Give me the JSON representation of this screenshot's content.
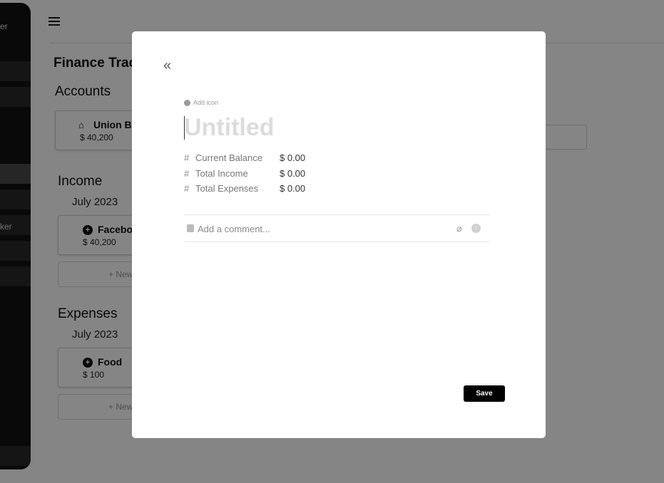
{
  "background": {
    "sidebar": {
      "item_top": "er",
      "item_mid": "ker"
    },
    "page_title": "Finance Track",
    "accounts": {
      "heading": "Accounts",
      "card": {
        "title": "Union Ba",
        "value": "$ 40,200",
        "icon": "bank-icon"
      }
    },
    "income": {
      "heading": "Income",
      "month": "July 2023",
      "card": {
        "title": "Faceboo",
        "value": "$ 40,200",
        "icon": "plus-circle-icon"
      },
      "new_label": "+ New"
    },
    "expenses": {
      "heading": "Expenses",
      "month": "July 2023",
      "card": {
        "title": "Food",
        "value": "$ 100",
        "icon": "plus-circle-icon"
      },
      "new_label": "+ New"
    }
  },
  "modal": {
    "add_icon_label": "Add icon",
    "title_placeholder": "Untitled",
    "properties": [
      {
        "name": "Current Balance",
        "value": "$ 0.00"
      },
      {
        "name": "Total Income",
        "value": "$ 0.00"
      },
      {
        "name": "Total Expenses",
        "value": "$ 0.00"
      }
    ],
    "comment_placeholder": "Add a comment...",
    "save_label": "Save"
  }
}
